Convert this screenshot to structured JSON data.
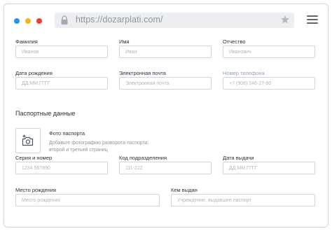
{
  "browser": {
    "url": "https://dozarplati.com/",
    "lock_icon": "lock-icon",
    "star_icon": "star-icon",
    "menu_icon": "hamburger-menu-icon",
    "traffic_lights": [
      "#2496e8",
      "#f7b418",
      "#ef3a36"
    ]
  },
  "form": {
    "last_name": {
      "label": "Фамилия",
      "placeholder": "Иванов"
    },
    "first_name": {
      "label": "Имя",
      "placeholder": "Иван"
    },
    "patronymic": {
      "label": "Отчество",
      "placeholder": "Иванович"
    },
    "birth_date": {
      "label": "Дата рождения",
      "placeholder": "ДД.ММ.ГГГГ"
    },
    "email": {
      "label": "Электронная почта",
      "placeholder": "Электронная почта"
    },
    "phone": {
      "label": "Номер телефона",
      "placeholder": "+7 (908) 246-27-90"
    }
  },
  "passport": {
    "title": "Паспортные данные",
    "photo_label": "Фото паспорта",
    "photo_hint": "Добавьте фотографию разворота паспорта: второй и третьей страниц",
    "camera_icon": "add-photo-camera-icon",
    "series_number": {
      "label": "Серия и номер",
      "placeholder": "1234 567890"
    },
    "division_code": {
      "label": "Код подразделения",
      "placeholder": "111-222"
    },
    "issue_date": {
      "label": "Дата выдачи",
      "placeholder": "ДД.ММ.ГГГГ"
    },
    "birth_place": {
      "label": "Место рождения",
      "placeholder": "Место рождения"
    },
    "issued_by": {
      "label": "Кем выдан",
      "placeholder": "Учреждение, выдавшее паспорт"
    }
  }
}
